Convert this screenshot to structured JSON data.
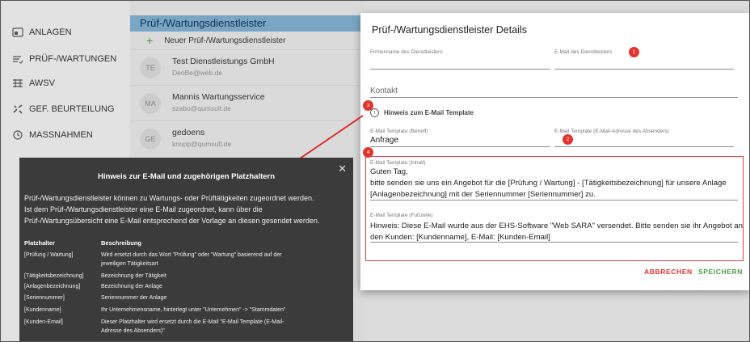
{
  "sidebar": {
    "items": [
      {
        "label": "ANLAGEN",
        "icon": "anlagen-icon"
      },
      {
        "label": "PRÜF-/WARTUNGEN",
        "icon": "wartungen-icon"
      },
      {
        "label": "AWSV",
        "icon": "awsv-icon"
      },
      {
        "label": "GEF. BEURTEILUNG",
        "icon": "beurteilung-icon"
      },
      {
        "label": "MASSNAHMEN",
        "icon": "massnahmen-icon"
      }
    ]
  },
  "list": {
    "title": "Prüf-/Wartungsdienstleister",
    "new_label": "Neuer Prüf-/Wartungsdienstleister",
    "entries": [
      {
        "initials": "TE",
        "name": "Test Dienstleistungs GmbH",
        "email": "DeoBe@web.de"
      },
      {
        "initials": "MA",
        "name": "Mannis Wartungsservice",
        "email": "szabo@qumsult.de"
      },
      {
        "initials": "GE",
        "name": "gedoens",
        "email": "knopp@qumsult.de"
      }
    ]
  },
  "dialog": {
    "title": "Prüf-/Wartungsdienstleister Details",
    "firmenname_label": "Firmenname des Dienstleisters",
    "email_label": "E-Mail des Dienstleisters",
    "kontakt_placeholder": "Kontakt",
    "hinweis_label": "Hinweis zum E-Mail Template",
    "betreff_label": "E-Mail Template (Betreff)",
    "betreff_value": "Anfrage",
    "absender_label": "E-Mail Template (E-Mail-Adresse des Absenders)",
    "inhalt_label": "E-Mail Template (Inhalt)",
    "inhalt_lines": [
      "Guten Tag,",
      "bitte senden sie uns ein Angebot für die [Prüfung / Wartung] - [Tätigkeitsbezeichnung] für unsere Anlage",
      "[Anlagenbezeichnung] mit der Seriennummer [Seriennummer] zu."
    ],
    "fusszeile_label": "E-Mail Template (Fußzeile)",
    "fusszeile_lines": [
      "Hinweis: Diese E-Mail wurde aus der EHS-Software \"Web SARA\" versendet. Bitte senden sie ihr Angebot an",
      "den Kunden: [Kundenname], E-Mail: [Kunden-Email]"
    ],
    "cancel_label": "ABBRECHEN",
    "save_label": "SPEICHERN",
    "badges": [
      "1",
      "2",
      "3",
      "4"
    ]
  },
  "tooltip": {
    "title": "Hinweis zur E-Mail und zugehörigen Platzhaltern",
    "paragraph": [
      "Prüf-/Wartungsdienstleister können zu Wartungs- oder Prüftätigkeiten zugeordnet werden.",
      "Ist dem Prüf-/Wartungsdienstleister eine E-Mail zugeordnet, kann über die",
      "Prüf-/Wartungsübersicht eine E-Mail entsprechend der Vorlage an diesen gesendet werden."
    ],
    "col_placeholder": "Platzhalter",
    "col_description": "Beschreibung",
    "rows": [
      {
        "key": "[Prüfung / Wartung]",
        "desc": [
          "Wird ersetzt durch das Wort \"Prüfung\" oder \"Wartung\" basierend auf der",
          "jeweiligen Tätigkeitsart"
        ]
      },
      {
        "key": "[Tätigkeitsbezeichnung]",
        "desc": [
          "Bezeichnung der Tätigkeit"
        ]
      },
      {
        "key": "[Anlagenbezeichnung]",
        "desc": [
          "Bezeichnung der Anlage"
        ]
      },
      {
        "key": "[Seriennummer]",
        "desc": [
          "Seriennummer der Anlage"
        ]
      },
      {
        "key": "[Kundenname]",
        "desc": [
          "Ihr Unternehmensname, hinterlegt unter \"Unternehmen\" -> \"Stammdaten\""
        ]
      },
      {
        "key": "[Kunden-Email]",
        "desc": [
          "Dieser Platzhalter wird ersetzt durch die E-Mail \"E-Mail Template (E-Mail-",
          "Adresse des Absenders)\""
        ]
      }
    ]
  },
  "colors": {
    "accent_green": "#4a9b4a",
    "accent_red": "#e2332f",
    "header_blue": "#7aa6c6"
  }
}
